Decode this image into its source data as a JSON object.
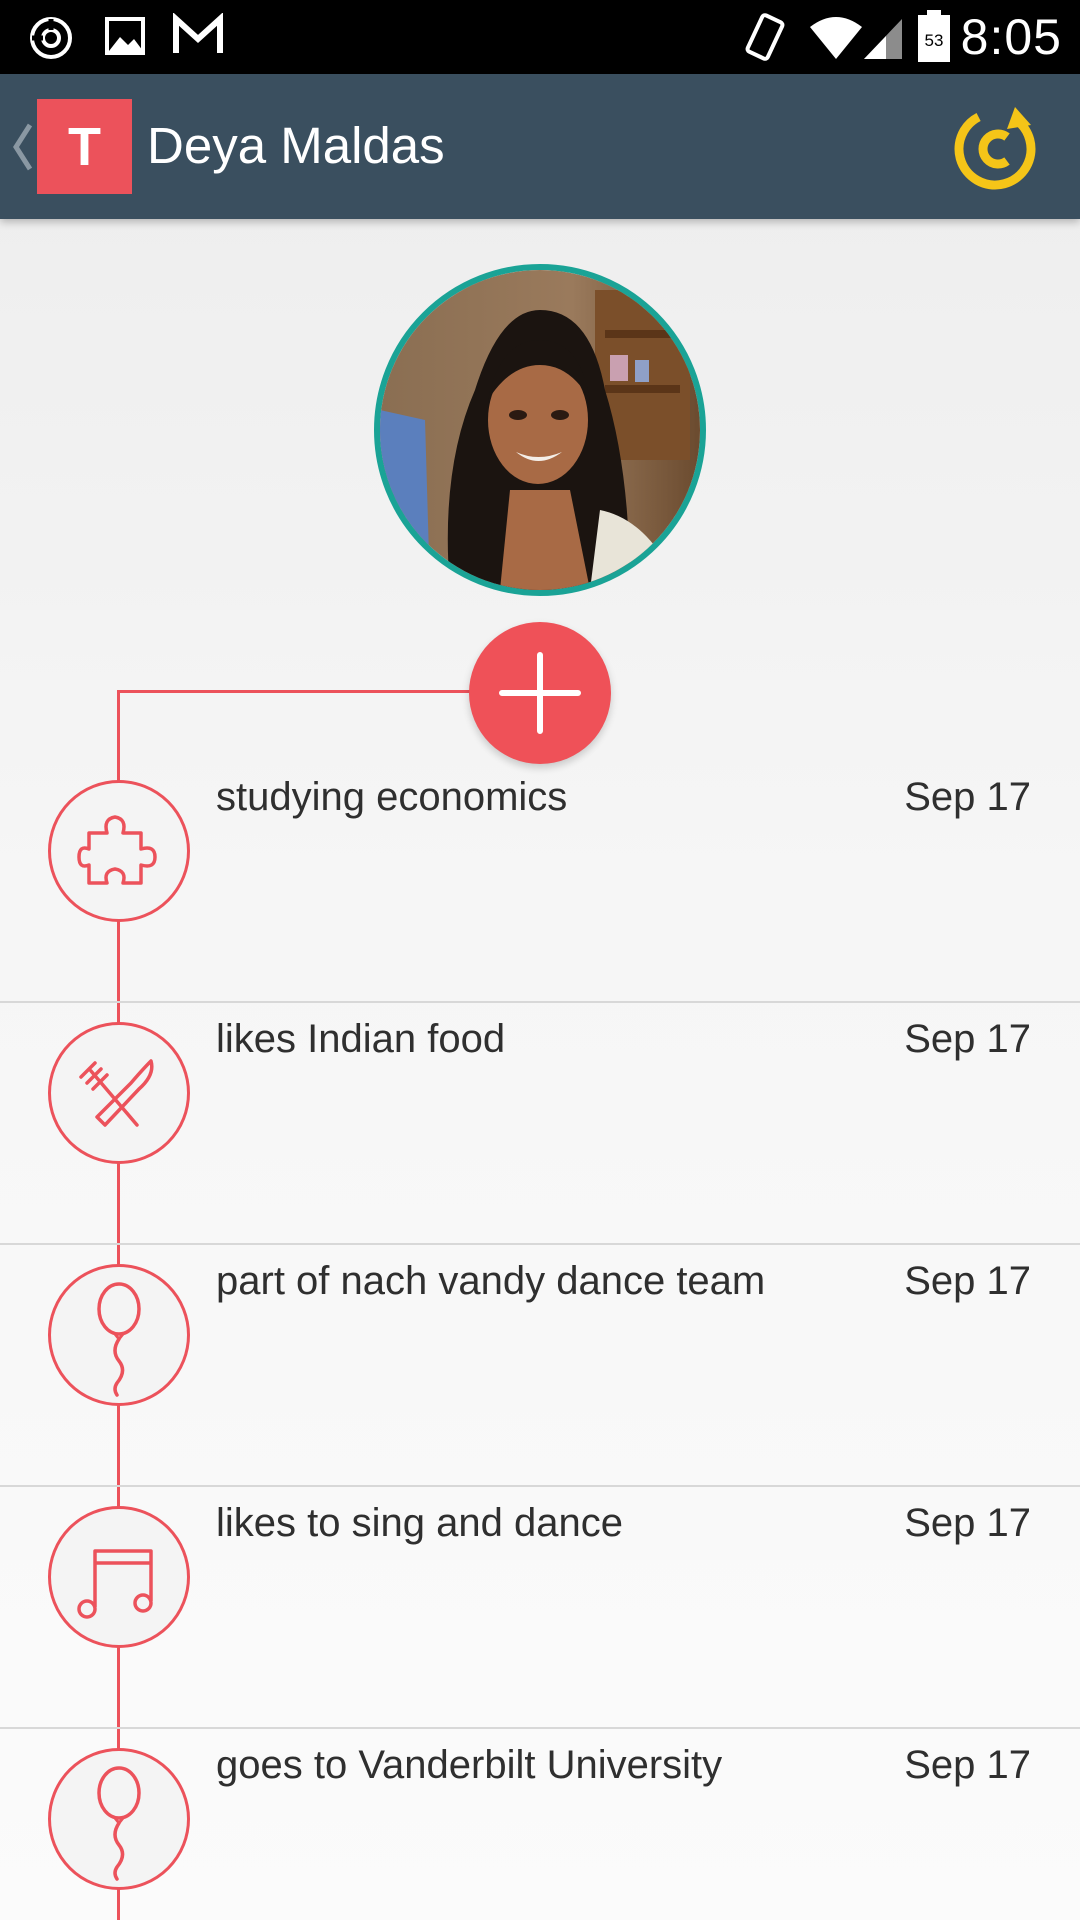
{
  "status_bar": {
    "time": "8:05",
    "battery_level": "53",
    "icons": [
      "sync-icon",
      "gallery-icon",
      "gmail-icon",
      "vibrate-icon",
      "wifi-icon",
      "signal-icon",
      "battery-icon"
    ]
  },
  "app_bar": {
    "logo_letter": "T",
    "title": "Deya Maldas",
    "back_icon": "chevron-left-icon",
    "refresh_icon": "refresh-icon"
  },
  "colors": {
    "accent": "#ec525b",
    "app_bar": "#3a4f5f",
    "avatar_ring": "#1aa396",
    "refresh": "#f5c518"
  },
  "timeline": {
    "add_icon": "plus-icon",
    "items": [
      {
        "icon": "puzzle-icon",
        "label": "studying economics",
        "date": "Sep 17"
      },
      {
        "icon": "fork-knife-icon",
        "label": "likes Indian food",
        "date": "Sep 17"
      },
      {
        "icon": "balloon-icon",
        "label": "part of nach vandy dance team",
        "date": "Sep 17"
      },
      {
        "icon": "music-note-icon",
        "label": "likes to sing and dance",
        "date": "Sep 17"
      },
      {
        "icon": "balloon-icon",
        "label": "goes to Vanderbilt University",
        "date": "Sep 17"
      }
    ]
  }
}
